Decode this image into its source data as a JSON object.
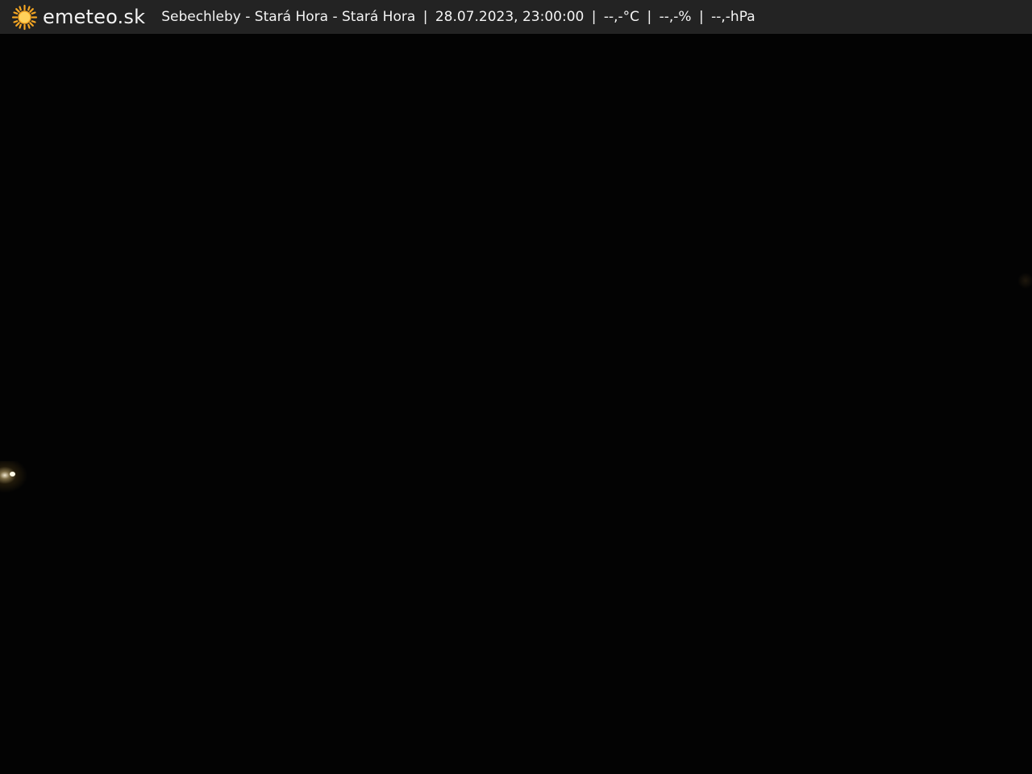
{
  "header": {
    "logo_text": "emeteo.sk",
    "location": "Sebechleby - Stará Hora - Stará Hora",
    "datetime": "28.07.2023, 23:00:00",
    "temperature": "--,-°C",
    "humidity": "--,-%",
    "pressure": "--,-hPa",
    "separator": "|"
  },
  "icons": {
    "logo": "sun-icon"
  },
  "colors": {
    "bar_background": "#232323",
    "sun": "#f5a623",
    "text": "#f4f4f4",
    "scene": "#030303"
  }
}
